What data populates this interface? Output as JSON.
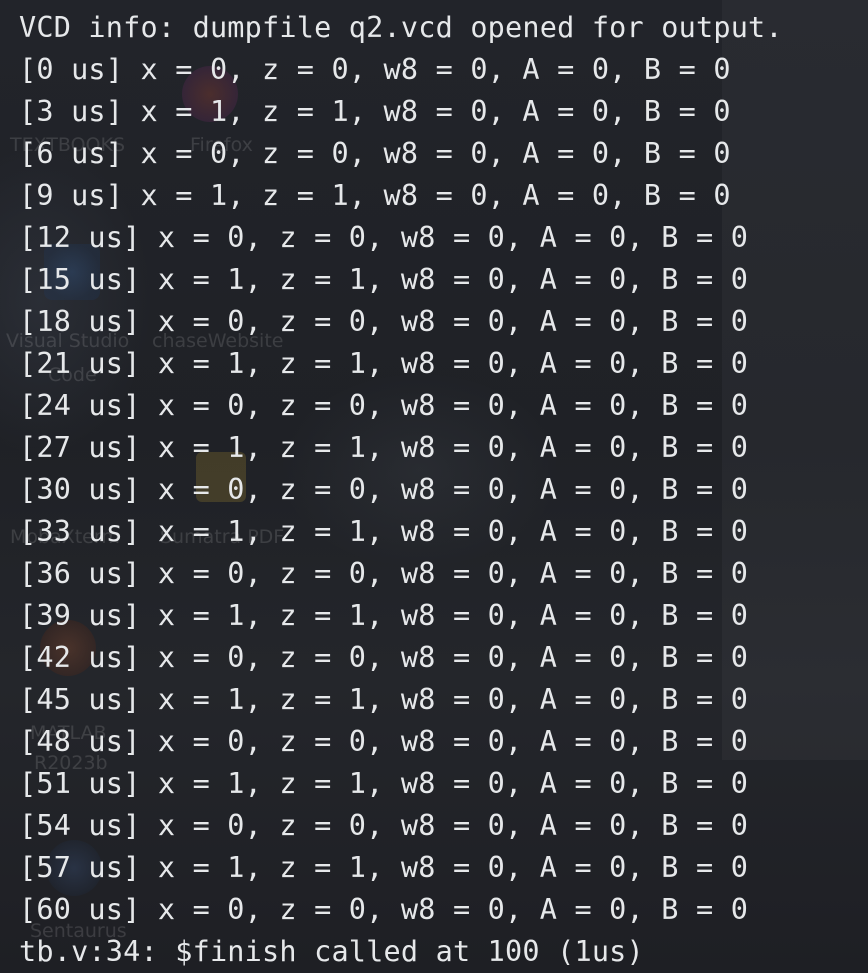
{
  "desktop": {
    "icon_labels": [
      "TEXTBOOKS",
      "Firefox",
      "Visual Studio",
      "chaseWebsite",
      "Code",
      "MobaXterm",
      "Sumatra PDF",
      "MATLAB",
      "R2023b",
      "Sentaurus"
    ]
  },
  "terminal": {
    "lines": [
      "VCD info: dumpfile q2.vcd opened for output.",
      "[0 us] x = 0, z = 0, w8 = 0, A = 0, B = 0",
      "[3 us] x = 1, z = 1, w8 = 0, A = 0, B = 0",
      "[6 us] x = 0, z = 0, w8 = 0, A = 0, B = 0",
      "[9 us] x = 1, z = 1, w8 = 0, A = 0, B = 0",
      "[12 us] x = 0, z = 0, w8 = 0, A = 0, B = 0",
      "[15 us] x = 1, z = 1, w8 = 0, A = 0, B = 0",
      "[18 us] x = 0, z = 0, w8 = 0, A = 0, B = 0",
      "[21 us] x = 1, z = 1, w8 = 0, A = 0, B = 0",
      "[24 us] x = 0, z = 0, w8 = 0, A = 0, B = 0",
      "[27 us] x = 1, z = 1, w8 = 0, A = 0, B = 0",
      "[30 us] x = 0, z = 0, w8 = 0, A = 0, B = 0",
      "[33 us] x = 1, z = 1, w8 = 0, A = 0, B = 0",
      "[36 us] x = 0, z = 0, w8 = 0, A = 0, B = 0",
      "[39 us] x = 1, z = 1, w8 = 0, A = 0, B = 0",
      "[42 us] x = 0, z = 0, w8 = 0, A = 0, B = 0",
      "[45 us] x = 1, z = 1, w8 = 0, A = 0, B = 0",
      "[48 us] x = 0, z = 0, w8 = 0, A = 0, B = 0",
      "[51 us] x = 1, z = 1, w8 = 0, A = 0, B = 0",
      "[54 us] x = 0, z = 0, w8 = 0, A = 0, B = 0",
      "[57 us] x = 1, z = 1, w8 = 0, A = 0, B = 0",
      "[60 us] x = 0, z = 0, w8 = 0, A = 0, B = 0",
      "tb.v:34: $finish called at 100 (1us)"
    ]
  },
  "colors": {
    "background": "#1e1f24",
    "text": "#e6e8ea",
    "highlight": "#e6a23c"
  }
}
